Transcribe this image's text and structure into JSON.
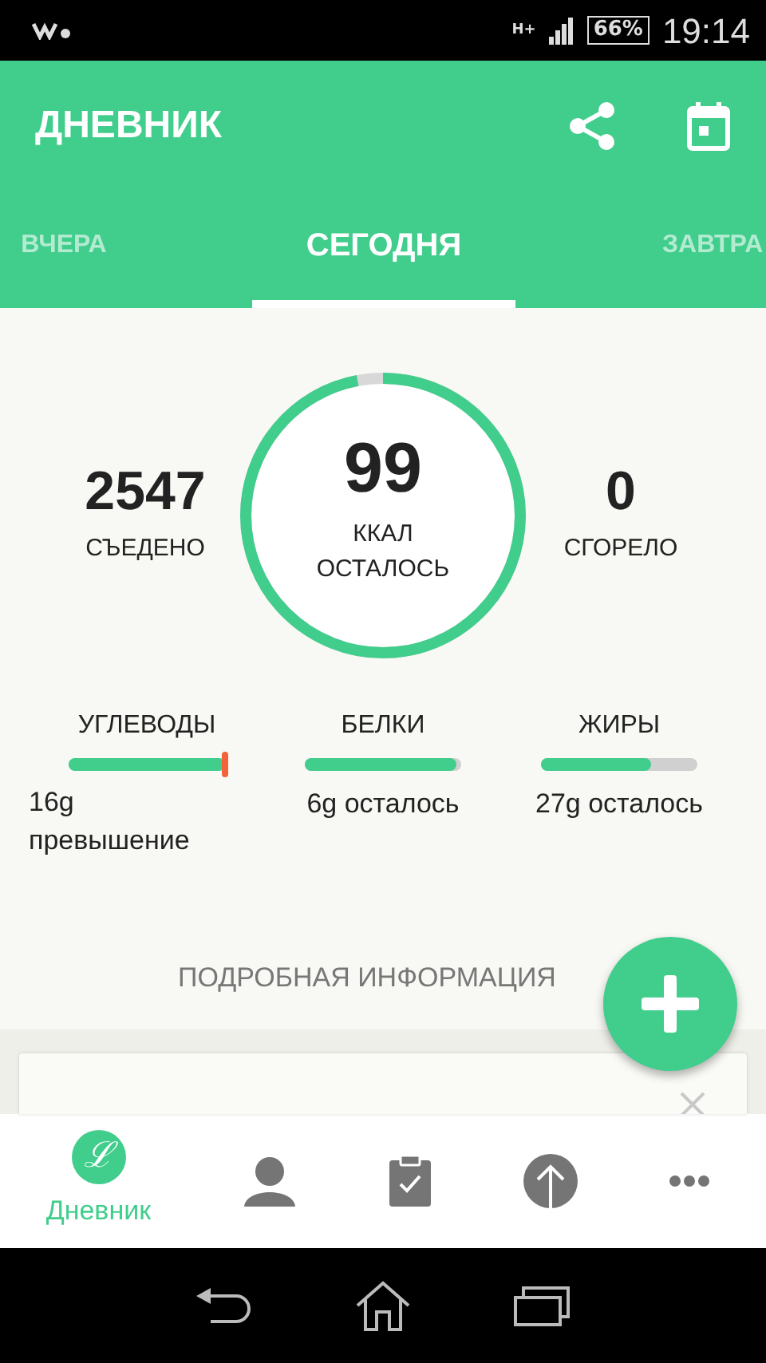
{
  "status_bar": {
    "battery": "66%",
    "network": "H+",
    "time": "19:14"
  },
  "app_bar": {
    "title": "ДНЕВНИК"
  },
  "tabs": [
    {
      "label": "ВЧЕРА",
      "selected": false
    },
    {
      "label": "СЕГОДНЯ",
      "selected": true
    },
    {
      "label": "ЗАВТРА",
      "selected": false
    }
  ],
  "summary": {
    "eaten": {
      "value": "2547",
      "label": "СЪЕДЕНО"
    },
    "remaining": {
      "value": "99",
      "unit": "ККАЛ",
      "label": "ОСТАЛОСЬ",
      "level": 0.97
    },
    "burned": {
      "value": "0",
      "label": "СГОРЕЛО"
    }
  },
  "macros": [
    {
      "name": "УГЛЕВОДЫ",
      "level": 1,
      "over": true,
      "reading": "16g превышение"
    },
    {
      "name": "БЕЛКИ",
      "level": 0.97,
      "over": false,
      "reading": "6g осталось"
    },
    {
      "name": "ЖИРЫ",
      "level": 0.7,
      "over": false,
      "reading": "27g осталось"
    }
  ],
  "details_link": "ПОДРОБНАЯ ИНФОРМАЦИЯ",
  "bottom_nav": [
    {
      "kind": "logo",
      "glyph": "ℒ",
      "label": "Дневник",
      "selected": true
    },
    {
      "kind": "profile",
      "selected": false
    },
    {
      "kind": "clipboard",
      "selected": false
    },
    {
      "kind": "upload",
      "selected": false
    },
    {
      "kind": "more",
      "selected": false
    }
  ]
}
